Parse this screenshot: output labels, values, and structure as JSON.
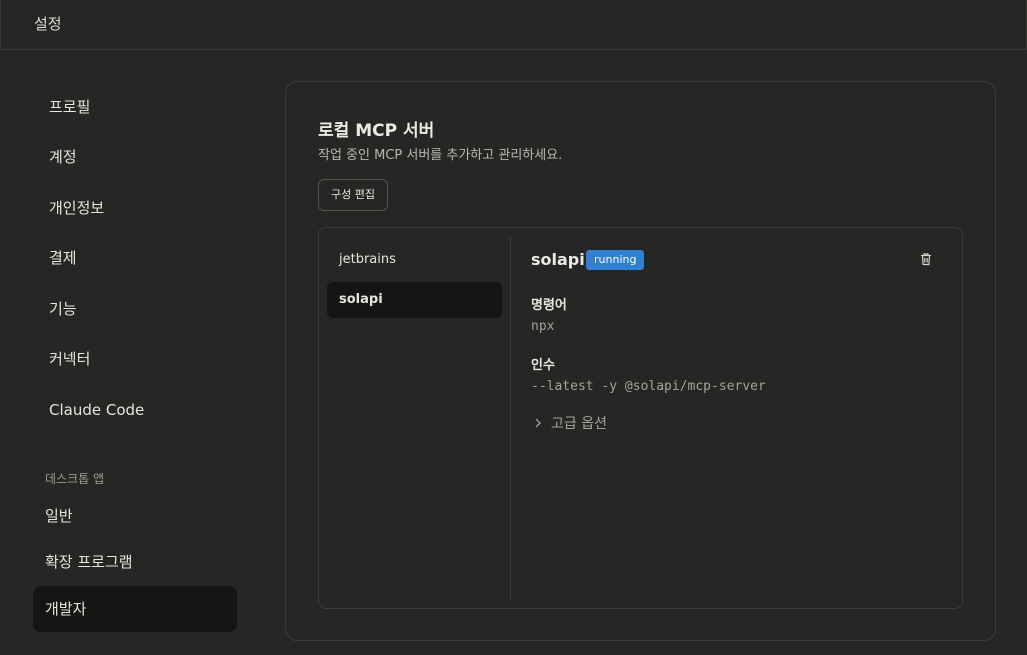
{
  "window": {
    "title": "설정"
  },
  "sidebar": {
    "items": [
      {
        "label": "프로필"
      },
      {
        "label": "계정"
      },
      {
        "label": "개인정보"
      },
      {
        "label": "결제"
      },
      {
        "label": "기능"
      },
      {
        "label": "커넥터"
      },
      {
        "label": "Claude Code"
      }
    ],
    "desktop_section": {
      "label": "데스크톱 앱",
      "items": [
        {
          "label": "일반"
        },
        {
          "label": "확장 프로그램"
        },
        {
          "label": "개발자",
          "active": true
        }
      ]
    }
  },
  "main": {
    "title": "로컬 MCP 서버",
    "subtitle": "작업 중인 MCP 서버를 추가하고 관리하세요.",
    "edit_button": "구성 편집",
    "servers": [
      {
        "name": "jetbrains"
      },
      {
        "name": "solapi",
        "active": true
      }
    ],
    "detail": {
      "name": "solapi",
      "status": "running",
      "command_label": "명령어",
      "command_value": "npx",
      "args_label": "인수",
      "args_value": "--latest -y @solapi/mcp-server",
      "advanced_label": "고급 옵션"
    }
  },
  "colors": {
    "background": "#262624",
    "active_item": "#151514",
    "status_badge": "#2f7fd3"
  },
  "icons": {
    "trash": "trash-icon",
    "chevron": "chevron-right-icon"
  }
}
